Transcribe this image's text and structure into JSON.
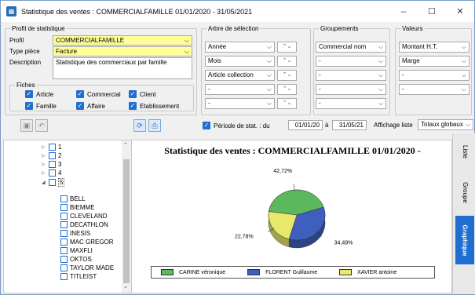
{
  "window": {
    "title": "Statistique des ventes  : COMMERCIALFAMILLE 01/01/2020 - 31/05/2021",
    "minimize": "–",
    "maximize": "☐",
    "close": "✕"
  },
  "profil": {
    "legend": "Profil de statistique",
    "profil_label": "Profil",
    "profil_value": "COMMERCIALFAMILLE",
    "type_label": "Type pièce",
    "type_value": "Facture",
    "desc_label": "Description",
    "desc_value": "Statistique des commerciaux par famille"
  },
  "fiches": {
    "legend": "Fiches",
    "items": [
      "Article",
      "Commercial",
      "Client",
      "Famille",
      "Affaire",
      "Etablissement"
    ]
  },
  "arbre": {
    "legend": "Arbre de sélection",
    "rows": [
      "Année",
      "Mois",
      "Article collection",
      "-",
      "-"
    ]
  },
  "groupements": {
    "legend": "Groupements",
    "rows": [
      "Commercial nom",
      "-",
      "-",
      "-",
      "-"
    ]
  },
  "valeurs": {
    "legend": "Valeurs",
    "rows": [
      "Montant H.T.",
      "Marge",
      "-",
      "-"
    ]
  },
  "period": {
    "label": "Période de stat. : du",
    "from": "01/01/20",
    "sep": "à",
    "to": "31/05/21",
    "affichage_label": "Affichage liste",
    "affichage_value": "Totaux globaux"
  },
  "tree": {
    "items": [
      "1",
      "2",
      "3",
      "4",
      "5"
    ],
    "children": [
      "BELL",
      "BIEMME",
      "CLEVELAND",
      "DECATHLON",
      "INESIS",
      "MAC GREGOR",
      "MAXFLI",
      "OKTOS",
      "TAYLOR MADE",
      "TITLEIST"
    ]
  },
  "side_tabs": [
    "Liste",
    "Groupe",
    "Graphique"
  ],
  "chart_data": {
    "type": "pie",
    "title": "Statistique des ventes  : COMMERCIALFAMILLE 01/01/2020 -",
    "categories": [
      "CARINE véronique",
      "FLORENT Guillaume",
      "XAVIER antoine"
    ],
    "values": [
      42.72,
      34.49,
      22.78
    ],
    "labels": [
      "42,72%",
      "34,49%",
      "22,78%"
    ],
    "colors": [
      "#5cb85c",
      "#3f5fbf",
      "#e8e86a"
    ]
  }
}
